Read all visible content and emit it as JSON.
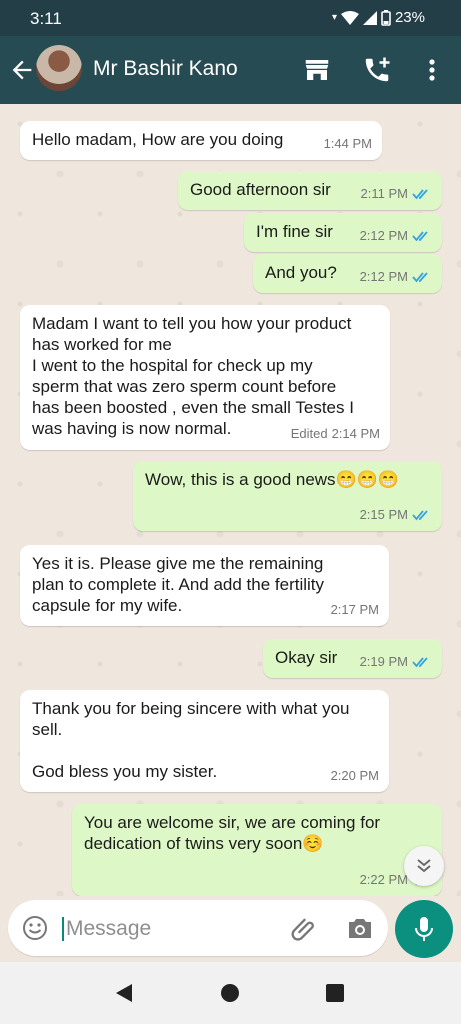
{
  "status": {
    "time": "3:11",
    "battery": "23%"
  },
  "header": {
    "contact_name": "Mr Bashir Kano",
    "icons": [
      "back-arrow-icon",
      "store-icon",
      "call-add-icon",
      "more-vert-icon"
    ]
  },
  "messages": [
    {
      "dir": "in",
      "text": "Hello madam, How are you doing",
      "time": "1:44 PM"
    },
    {
      "dir": "out",
      "text": "Good afternoon sir",
      "time": "2:11 PM"
    },
    {
      "dir": "out",
      "text": "I'm fine sir",
      "time": "2:12 PM"
    },
    {
      "dir": "out",
      "text": "And you?",
      "time": "2:12 PM"
    },
    {
      "dir": "in",
      "text": "Madam I want to tell you how your product\nhas worked for me\nI went to the hospital for check up my\nsperm that was zero sperm count before\nhas been boosted , even the small Testes I\nwas having is now normal.",
      "time": "2:14 PM",
      "edited": "Edited"
    },
    {
      "dir": "out",
      "text": "Wow, this is a good news😁😁😁",
      "time": "2:15 PM"
    },
    {
      "dir": "in",
      "text": "Yes it is. Please give me the remaining\nplan to complete it. And add the fertility\ncapsule for my wife.",
      "time": "2:17 PM"
    },
    {
      "dir": "out",
      "text": "Okay sir",
      "time": "2:19 PM"
    },
    {
      "dir": "in",
      "text": "Thank you for being sincere with what you\nsell.\n\nGod bless you my sister.",
      "time": "2:20 PM"
    },
    {
      "dir": "out",
      "text": "You are welcome sir, we are coming for\ndedication of twins very soon☺️",
      "time": "2:22 PM"
    }
  ],
  "composer": {
    "placeholder": "Message"
  },
  "colors": {
    "header": "#274b53",
    "outgoing": "#ddf8c6",
    "incoming": "#ffffff",
    "accent": "#0b8f7e",
    "tick": "#34a3dd"
  }
}
